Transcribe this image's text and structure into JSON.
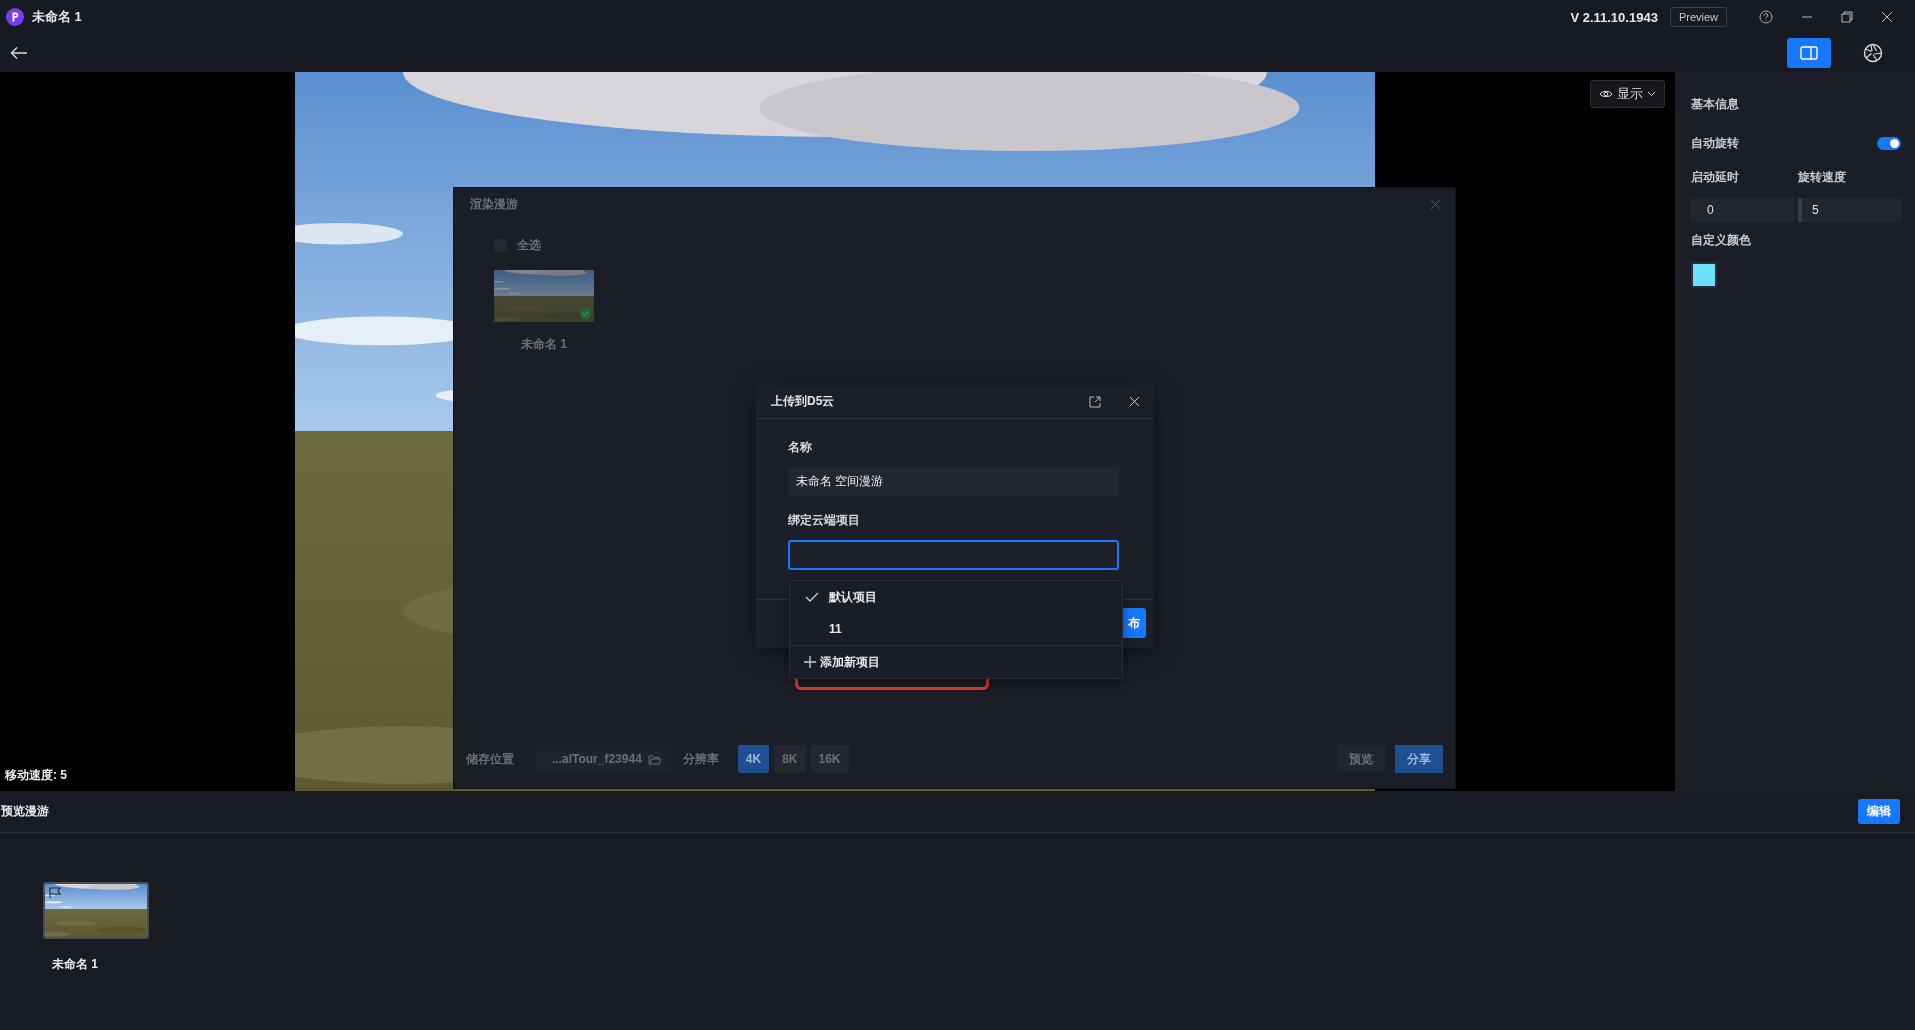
{
  "window": {
    "title": "未命名 1",
    "version": "V 2.11.10.1943",
    "preview_button": "Preview"
  },
  "toolbar": {
    "tools": [
      {
        "kind": "panel",
        "selected": true
      },
      {
        "kind": "aperture",
        "selected": false
      }
    ]
  },
  "viewport": {
    "display_menu": "显示",
    "move_speed": "移动速度: 5"
  },
  "side_panel": {
    "section_title": "基本信息",
    "auto_rotate": {
      "label": "自动旋转",
      "on": true
    },
    "fields": [
      {
        "label": "启动延时",
        "value": "0"
      },
      {
        "label": "旋转速度",
        "value": "5"
      }
    ],
    "custom_color": {
      "label": "自定义颜色",
      "color": "#6ee0ff"
    }
  },
  "bottom_panel": {
    "title": "预览漫游",
    "edit_button": "编辑",
    "items": [
      {
        "name": "未命名 1"
      }
    ]
  },
  "render_dialog": {
    "title": "渲染漫游",
    "select_all": {
      "label": "全选",
      "checked": false
    },
    "items": [
      {
        "name": "未命名 1",
        "done": true
      }
    ],
    "storage_label": "储存位置",
    "storage_path": "...alTour_f23944",
    "resolution_label": "分辨率",
    "resolutions": [
      {
        "label": "4K",
        "selected": true
      },
      {
        "label": "8K",
        "selected": false
      },
      {
        "label": "16K",
        "selected": false
      }
    ],
    "preview_button": "预览",
    "share_button": "分享"
  },
  "upload_dialog": {
    "title": "上传到D5云",
    "name_label": "名称",
    "name_value": "未命名 空间漫游",
    "project_label": "绑定云端项目",
    "publish_button": "布",
    "dropdown": [
      {
        "kind": "option",
        "label": "默认项目",
        "selected": true
      },
      {
        "kind": "option",
        "label": "11",
        "selected": false
      },
      {
        "kind": "add",
        "label": "添加新项目",
        "highlighted": true
      }
    ]
  }
}
